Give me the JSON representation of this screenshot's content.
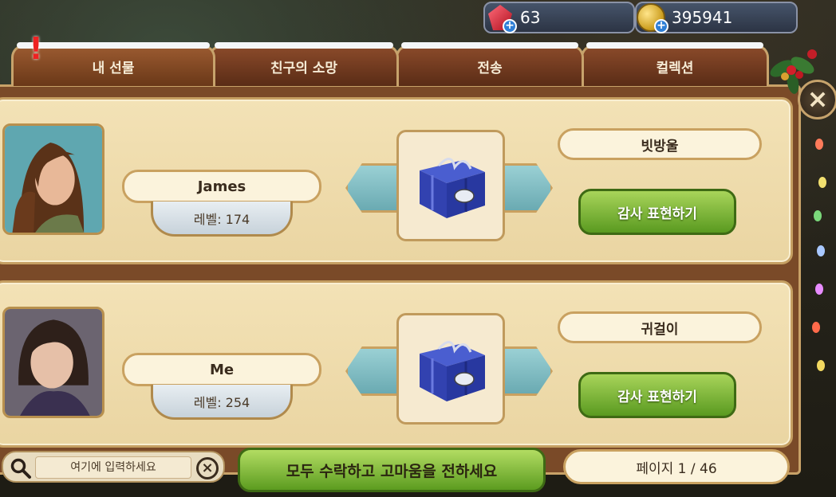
{
  "currency": {
    "gems": "63",
    "coins": "395941"
  },
  "tabs": [
    {
      "label": "내 선물",
      "active": true
    },
    {
      "label": "친구의 소망",
      "active": false
    },
    {
      "label": "전송",
      "active": false
    },
    {
      "label": "컬렉션",
      "active": false
    }
  ],
  "gifts": [
    {
      "sender": "James",
      "level": "레벨: 174",
      "item": "빗방울",
      "action": "감사 표현하기"
    },
    {
      "sender": "Me",
      "level": "레벨: 254",
      "item": "귀걸이",
      "action": "감사 표현하기"
    }
  ],
  "search": {
    "placeholder": "여기에 입력하세요"
  },
  "accept_all_label": "모두 수락하고 고마움을 전하세요",
  "pagination": "페이지 1 / 46",
  "colors": {
    "accept": "#7cb83a",
    "tab": "#7a3e20",
    "panel": "#f0dcad",
    "ribbon": "#7fbcc2"
  }
}
